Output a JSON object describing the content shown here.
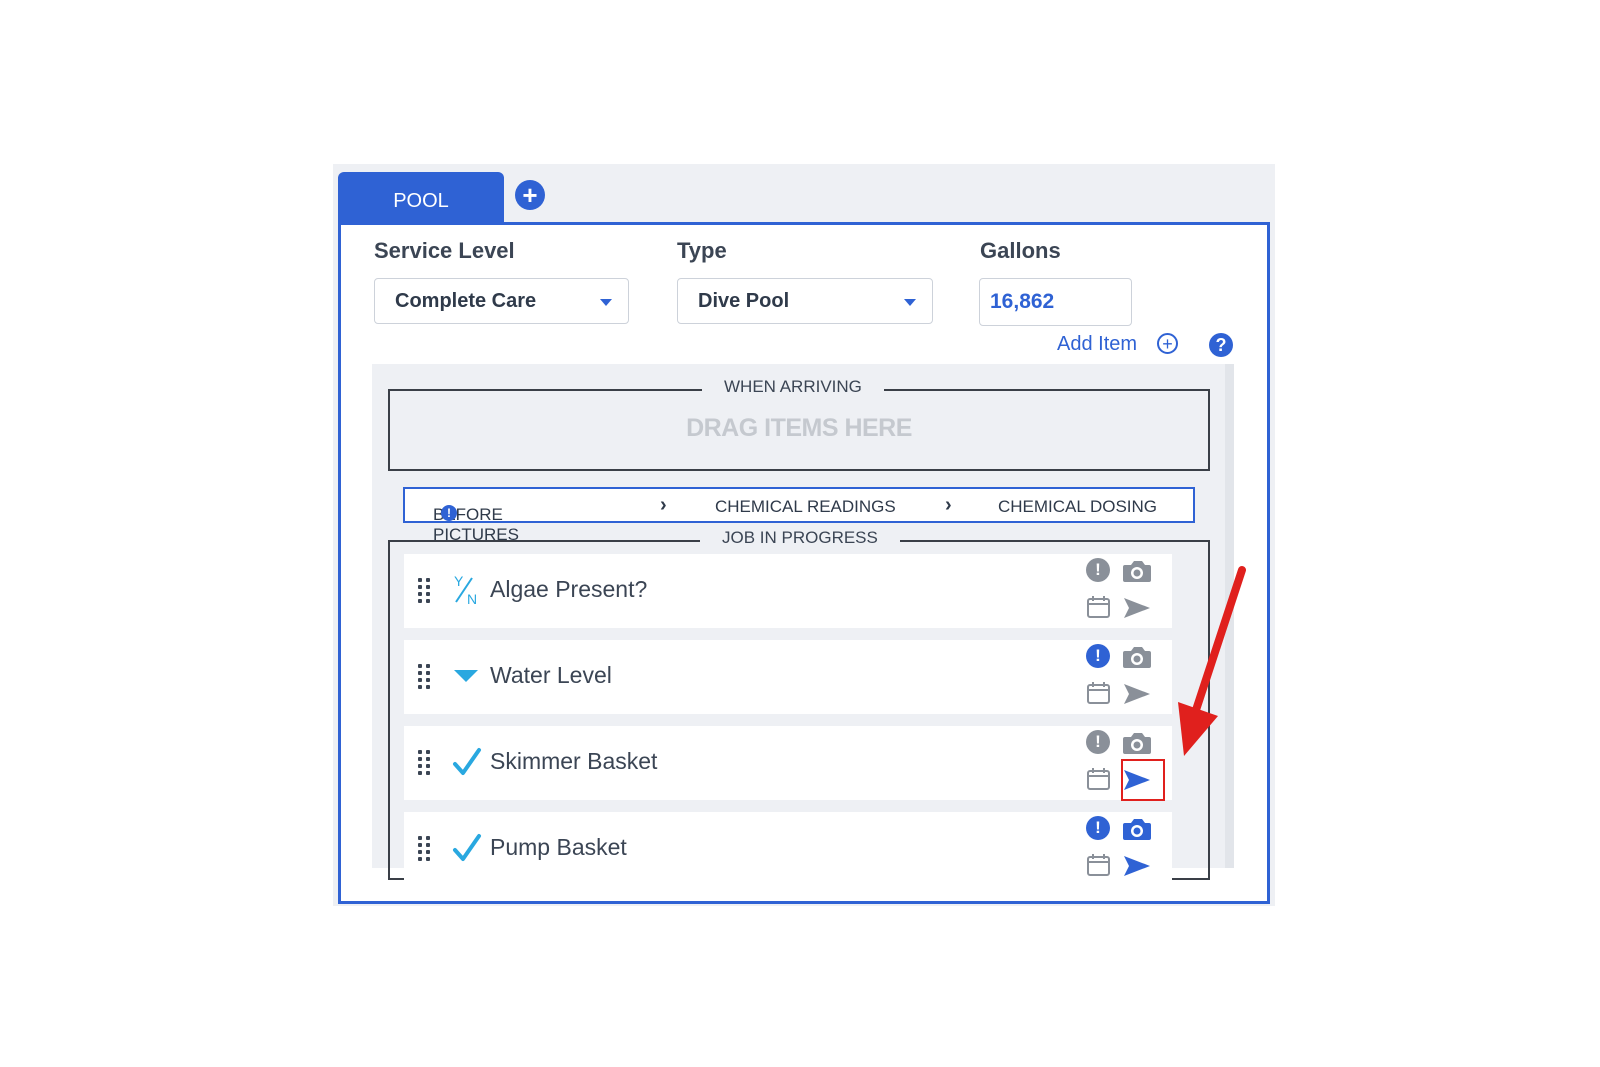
{
  "tabs": {
    "active_label": "POOL",
    "add_tab_icon": "plus-circle-icon"
  },
  "fields": {
    "service_level": {
      "label": "Service Level",
      "value": "Complete Care"
    },
    "type": {
      "label": "Type",
      "value": "Dive Pool"
    },
    "gallons": {
      "label": "Gallons",
      "value": "16,862"
    }
  },
  "toolbar": {
    "add_item_label": "Add Item",
    "add_item_icon": "plus-circle-icon",
    "help_icon": "question-icon"
  },
  "sections": {
    "when_arriving": {
      "title": "WHEN ARRIVING",
      "drop_hint": "DRAG ITEMS HERE"
    },
    "steps": [
      "BEFORE PICTURES",
      "CHEMICAL READINGS",
      "CHEMICAL DOSING"
    ],
    "job_in_progress": {
      "title": "JOB IN PROGRESS"
    }
  },
  "checklist": [
    {
      "label": "Algae Present?",
      "type_icon": "yes-no-icon",
      "alert_active": false,
      "camera_active": false,
      "send_active": false
    },
    {
      "label": "Water Level",
      "type_icon": "dropdown-icon",
      "alert_active": true,
      "camera_active": false,
      "send_active": false
    },
    {
      "label": "Skimmer Basket",
      "type_icon": "checkmark-icon",
      "alert_active": false,
      "camera_active": false,
      "send_active": true
    },
    {
      "label": "Pump Basket",
      "type_icon": "checkmark-icon",
      "alert_active": true,
      "camera_active": true,
      "send_active": true
    }
  ],
  "colors": {
    "accent": "#2f62d4",
    "inactive": "#8a9099",
    "type_icon": "#29a8e0",
    "annotation": "#e0201d"
  }
}
